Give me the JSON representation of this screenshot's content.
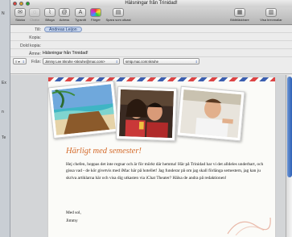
{
  "window": {
    "title": "Hälsningar från Trinidad!"
  },
  "sidebar_fragments": [
    "N",
    "Ex",
    "n",
    "Te"
  ],
  "toolbar": {
    "buttons": [
      {
        "label": "Skicka",
        "icon": "send-icon",
        "disabled": false
      },
      {
        "label": "Chatta",
        "icon": "chat-icon",
        "disabled": true
      },
      {
        "label": "Bifoga",
        "icon": "paperclip-icon",
        "disabled": false
      },
      {
        "label": "Adress",
        "icon": "address-book-icon",
        "disabled": false
      },
      {
        "label": "Typsnitt",
        "icon": "font-icon",
        "disabled": false
      },
      {
        "label": "Färger",
        "icon": "color-wheel-icon",
        "disabled": false
      },
      {
        "label": "Spara som utkast",
        "icon": "save-draft-icon",
        "disabled": false
      }
    ],
    "right_buttons": [
      {
        "label": "Bildbläddrare",
        "icon": "photo-browser-icon"
      },
      {
        "label": "Visa brevmallar",
        "icon": "stationery-icon"
      }
    ]
  },
  "header": {
    "to_label": "Till:",
    "to_value": "Andreas Leijon",
    "cc_label": "Kopia:",
    "cc_value": "",
    "bcc_label": "Dold kopia:",
    "bcc_value": "",
    "subject_label": "Ämne:",
    "subject_value": "Hälsningar från Trinidad!",
    "from_label": "Från:",
    "from_value": "Jimmy Lee Skruhe <skruhe@mac.com>",
    "smtp_value": "smtp.mac.com:skruhe",
    "options_value": "≡ ▾"
  },
  "message": {
    "headline": "Härligt med semester!",
    "body": "Hej chefen, hoppas det inte regnar och är för mörkt där hemma! Här på Trinidad har vi det alldeles underbart, och gissa vad - de kör givetvis med iMac här på hotellet! Jag funderar på om jag skall förlänga semestern, jag kan ju skriva artiklarna här och visa dig utkasten via iChat Theater? Hälsa de andra på redaktionen!",
    "closing": "Med sol,",
    "signature": "Jimmy"
  },
  "colors": {
    "accent_headline": "#d46a2a",
    "token_bg": "#c8d6ee",
    "scroll_thumb": "#2f62b8"
  }
}
